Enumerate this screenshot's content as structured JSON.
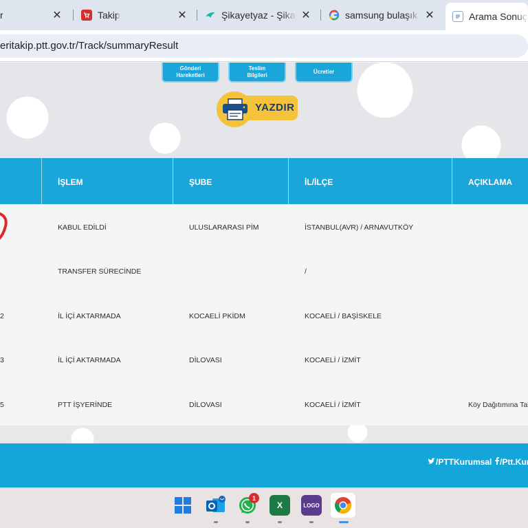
{
  "browser": {
    "tabs": [
      {
        "title": "r",
        "favicon": "none-icon"
      },
      {
        "title": "Takip",
        "favicon": "cart-icon",
        "color": "#d32f2f"
      },
      {
        "title": "Şikayetyaz - Şikayet",
        "favicon": "bird-icon",
        "color": "#19b6a6"
      },
      {
        "title": "samsung bulaşık m",
        "favicon": "google-icon"
      },
      {
        "title": "Arama Sonuçları",
        "favicon": "document-icon"
      }
    ],
    "close_glyph": "✕",
    "url": "eritakip.ptt.gov.tr/Track/summaryResult"
  },
  "page": {
    "quick_buttons": [
      {
        "label_line1": "Gönderi",
        "label_line2": "Hareketleri"
      },
      {
        "label_line1": "Teslim",
        "label_line2": "Bilgileri"
      },
      {
        "label_line1": "Ücretler",
        "label_line2": ""
      }
    ],
    "print_label": "YAZDIR",
    "table": {
      "headers": [
        "İŞLEM",
        "ŞUBE",
        "İL/İLÇE",
        "AÇIKLAMA"
      ],
      "rows": [
        {
          "prefix": "",
          "islem": "KABUL EDİLDİ",
          "sube": "ULUSLARARASI PİM",
          "il_ilce": "İSTANBUL(AVR) / ARNAVUTKÖY",
          "aciklama": ""
        },
        {
          "prefix": "",
          "islem": "TRANSFER SÜRECİNDE",
          "sube": "",
          "il_ilce": "/",
          "aciklama": ""
        },
        {
          "prefix": "2",
          "islem": "İL İÇİ AKTARMADA",
          "sube": "KOCAELİ PKİDM",
          "il_ilce": "KOCAELİ / BAŞİSKELE",
          "aciklama": ""
        },
        {
          "prefix": "3",
          "islem": "İL İÇİ AKTARMADA",
          "sube": "DİLOVASI",
          "il_ilce": "KOCAELİ / İZMİT",
          "aciklama": ""
        },
        {
          "prefix": "5",
          "islem": "PTT İŞYERİNDE",
          "sube": "DİLOVASI",
          "il_ilce": "KOCAELİ / İZMİT",
          "aciklama": "Köy Dağıtımına Tab"
        }
      ]
    },
    "footer": {
      "twitter": "/PTTKurumsal",
      "facebook": "/Ptt.Kur"
    }
  },
  "taskbar": {
    "whatsapp_badge": "1",
    "excel_letter": "X",
    "logo_text": "LOGO"
  }
}
